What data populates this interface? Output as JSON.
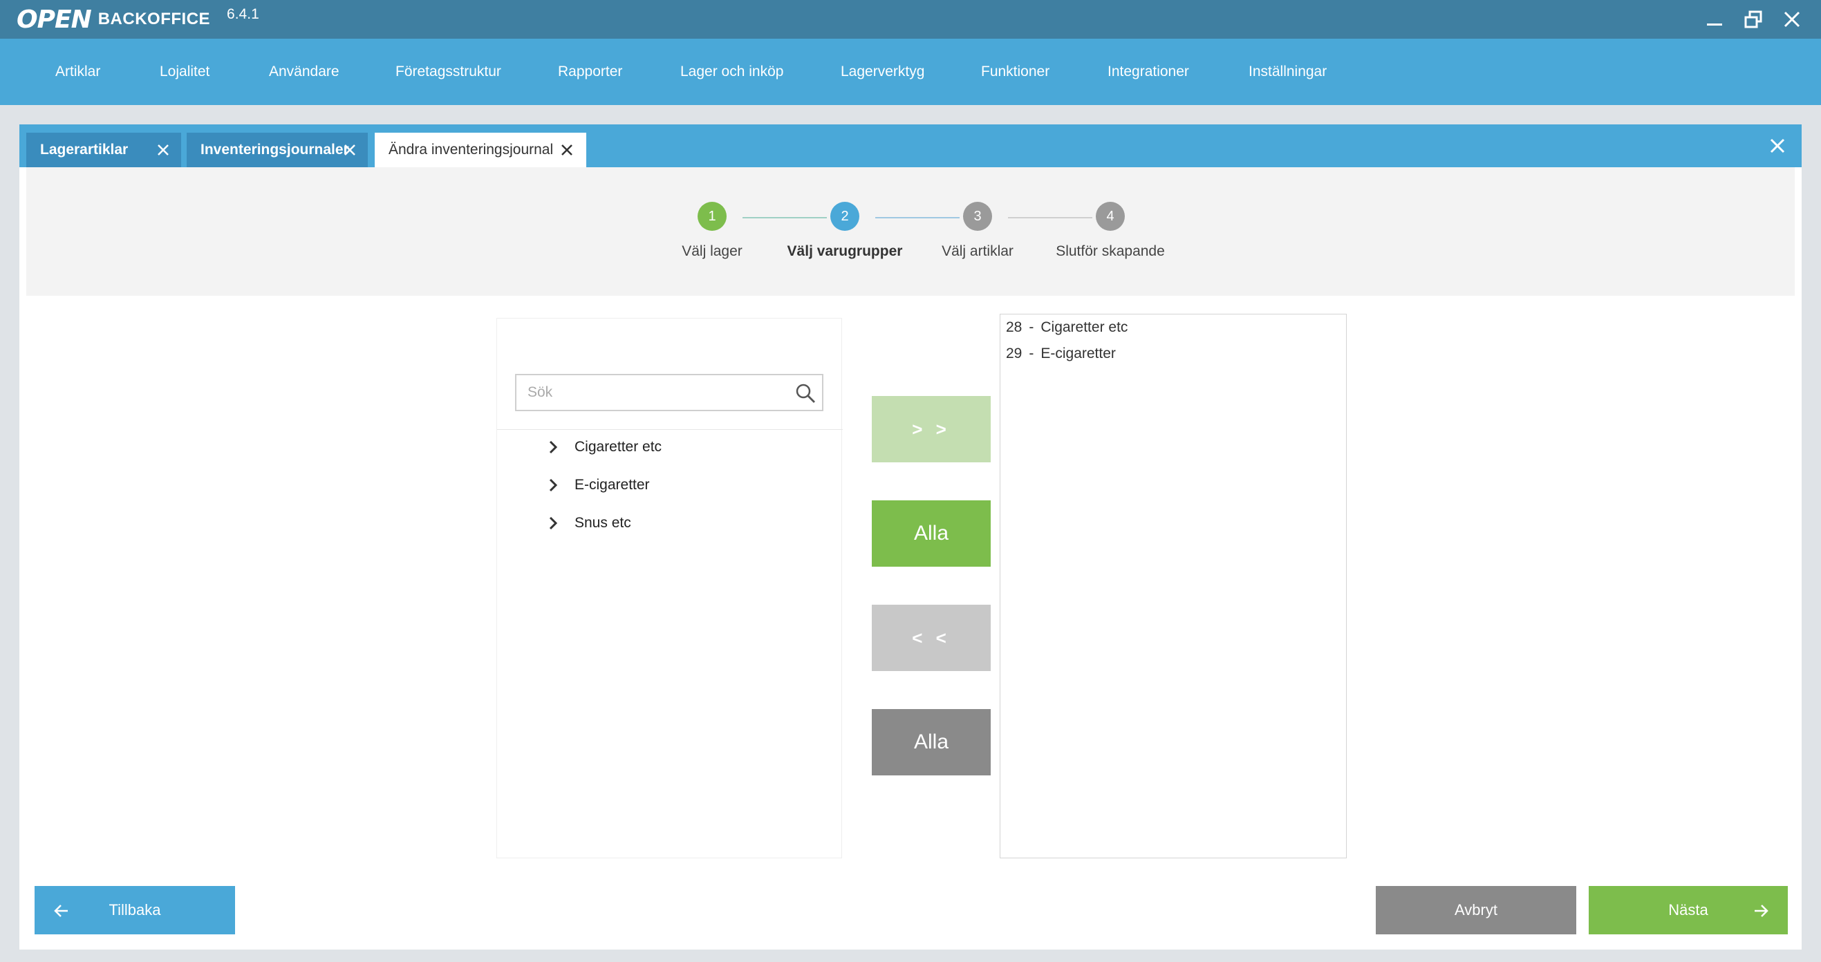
{
  "app": {
    "logo": "OPEN",
    "title": "BACKOFFICE",
    "version": "6.4.1"
  },
  "window_controls": [
    "minimize-icon",
    "restore-icon",
    "close-icon"
  ],
  "menu": {
    "items": [
      "Artiklar",
      "Lojalitet",
      "Användare",
      "Företagsstruktur",
      "Rapporter",
      "Lager och inköp",
      "Lagerverktyg",
      "Funktioner",
      "Integrationer",
      "Inställningar"
    ]
  },
  "tabs": [
    {
      "label": "Lagerartiklar",
      "active": false
    },
    {
      "label": "Inventeringsjournaler",
      "active": false
    },
    {
      "label": "Ändra inventeringsjournal",
      "active": true
    }
  ],
  "stepper": {
    "steps": [
      {
        "number": "1",
        "label": "Välj lager",
        "state": "done",
        "color": "#7dbd4c"
      },
      {
        "number": "2",
        "label": "Välj varugrupper",
        "state": "current",
        "color": "#4aa8d8"
      },
      {
        "number": "3",
        "label": "Välj artiklar",
        "state": "pending",
        "color": "#9a9a9a"
      },
      {
        "number": "4",
        "label": "Slutför skapande",
        "state": "pending",
        "color": "#9a9a9a"
      }
    ]
  },
  "search": {
    "placeholder": "Sök"
  },
  "available_groups": [
    "Cigaretter etc",
    "E-cigaretter",
    "Snus etc"
  ],
  "transfer": {
    "add_selected": "> >",
    "add_all": "Alla",
    "remove_selected": "< <",
    "remove_all": "Alla"
  },
  "selected_groups": [
    {
      "code": "28",
      "sep": "-",
      "name": "Cigaretter etc"
    },
    {
      "code": "29",
      "sep": "-",
      "name": "E-cigaretter"
    }
  ],
  "footer": {
    "back": "Tillbaka",
    "cancel": "Avbryt",
    "next": "Nästa"
  },
  "colors": {
    "titlebar": "#3f7fa1",
    "accent_blue": "#4aa8d8",
    "green": "#7dbd4c",
    "light_green": "#c4deb1",
    "gray": "#8a8a8a",
    "light_gray": "#c8c8c8"
  }
}
